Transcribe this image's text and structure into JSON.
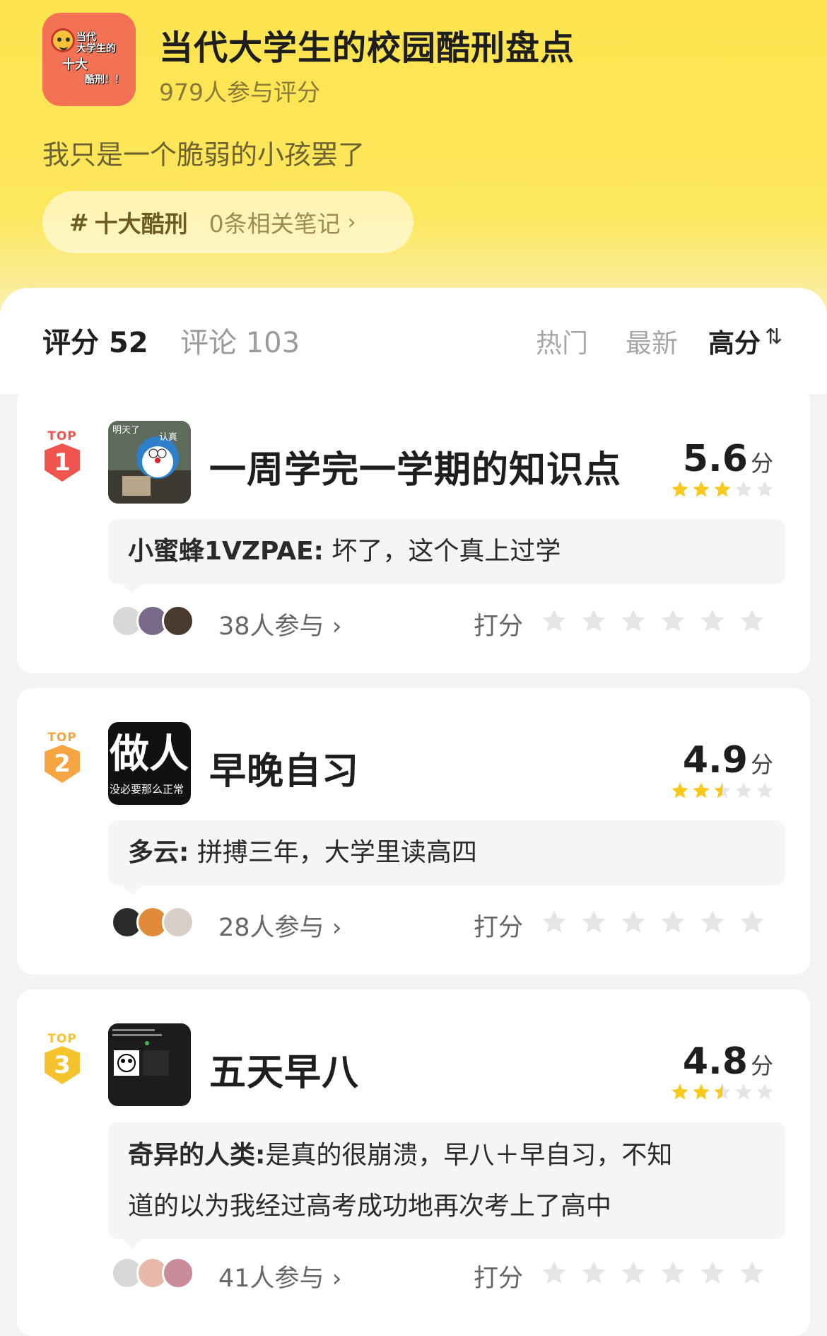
{
  "header": {
    "title": "当代大学生的校园酷刑盘点",
    "participants": "979人参与评分",
    "subtitle": "我只是一个脆弱的小孩罢了",
    "icon_text": [
      "当代",
      "大学生的",
      "十大",
      "酷刑！！"
    ],
    "topic": {
      "hash": "#",
      "name": "十大酷刑",
      "notes": "0条相关笔记",
      "chevron": "›"
    }
  },
  "tabs": {
    "rating": "评分 52",
    "comments": "评论 103"
  },
  "sort": {
    "hot": "热门",
    "latest": "最新",
    "high": "高分",
    "icon": "⇅"
  },
  "items": [
    {
      "rank": "1",
      "top_label": "TOP",
      "rank_color": "#f0544f",
      "thumb_text": [
        "明天了",
        "认真"
      ],
      "title": "一周学完一学期的知识点",
      "score": "5.6",
      "score_unit": "分",
      "stars": 3,
      "comment": {
        "author": "小蜜蜂1VZPAE:",
        "text": "坏了，这个真上过学"
      },
      "participants": "38人参与 ›",
      "rate_label": "打分"
    },
    {
      "rank": "2",
      "top_label": "TOP",
      "rank_color": "#f7a543",
      "thumb_text": [
        "做人",
        "没必要那么正常"
      ],
      "title": "早晚自习",
      "score": "4.9",
      "score_unit": "分",
      "stars": 2.5,
      "comment": {
        "author": "多云:",
        "text": "拼搏三年，大学里读高四"
      },
      "participants": "28人参与 ›",
      "rate_label": "打分"
    },
    {
      "rank": "3",
      "top_label": "TOP",
      "rank_color": "#f5c32c",
      "thumb_text": [],
      "title": "五天早八",
      "score": "4.8",
      "score_unit": "分",
      "stars": 2.5,
      "comment": {
        "author": "奇异的人类:",
        "text": "是真的很崩溃，早八＋早自习，不知",
        "text2": "道的以为我经过高考成功地再次考上了高中"
      },
      "participants": "41人参与 ›",
      "rate_label": "打分"
    }
  ],
  "colors": {
    "accent_yellow": "#fde44f",
    "star_yellow": "#f8c81d",
    "star_empty": "#e5e5e5"
  }
}
